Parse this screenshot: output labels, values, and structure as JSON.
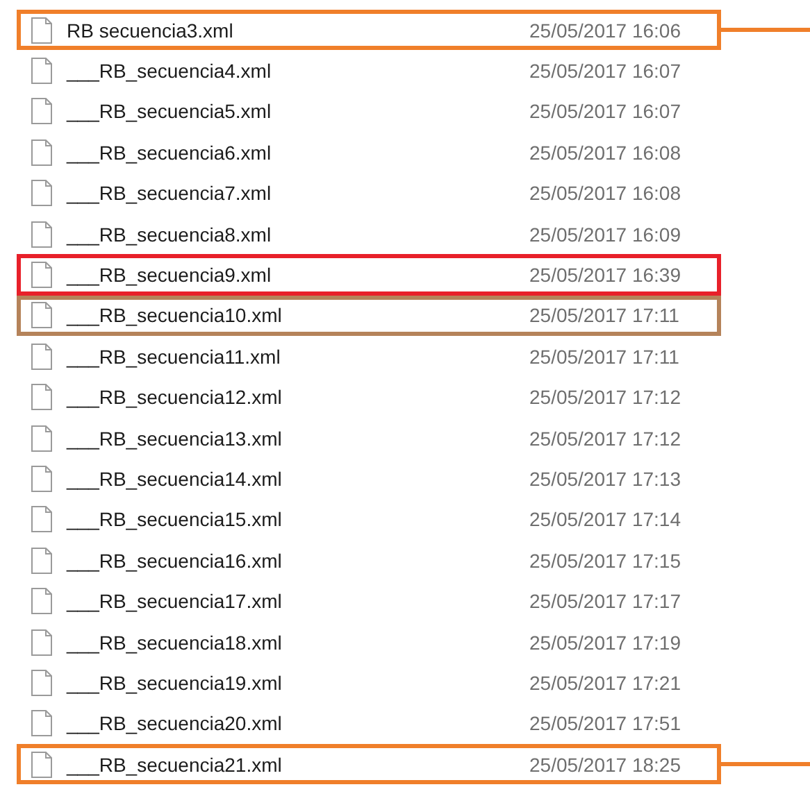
{
  "files": [
    {
      "name": "RB secuencia3.xml",
      "modified": "25/05/2017 16:06",
      "color": "#f07f2a",
      "connector": true
    },
    {
      "name": "___RB_secuencia4.xml",
      "modified": "25/05/2017 16:07"
    },
    {
      "name": "___RB_secuencia5.xml",
      "modified": "25/05/2017 16:07"
    },
    {
      "name": "___RB_secuencia6.xml",
      "modified": "25/05/2017 16:08"
    },
    {
      "name": "___RB_secuencia7.xml",
      "modified": "25/05/2017 16:08"
    },
    {
      "name": "___RB_secuencia8.xml",
      "modified": "25/05/2017 16:09"
    },
    {
      "name": "___RB_secuencia9.xml",
      "modified": "25/05/2017 16:39",
      "color": "#e8202a"
    },
    {
      "name": "___RB_secuencia10.xml",
      "modified": "25/05/2017 17:11",
      "color": "#b5835a"
    },
    {
      "name": "___RB_secuencia11.xml",
      "modified": "25/05/2017 17:11"
    },
    {
      "name": "___RB_secuencia12.xml",
      "modified": "25/05/2017 17:12"
    },
    {
      "name": "___RB_secuencia13.xml",
      "modified": "25/05/2017 17:12"
    },
    {
      "name": "___RB_secuencia14.xml",
      "modified": "25/05/2017 17:13"
    },
    {
      "name": "___RB_secuencia15.xml",
      "modified": "25/05/2017 17:14"
    },
    {
      "name": "___RB_secuencia16.xml",
      "modified": "25/05/2017 17:15"
    },
    {
      "name": "___RB_secuencia17.xml",
      "modified": "25/05/2017 17:17"
    },
    {
      "name": "___RB_secuencia18.xml",
      "modified": "25/05/2017 17:19"
    },
    {
      "name": "___RB_secuencia19.xml",
      "modified": "25/05/2017 17:21"
    },
    {
      "name": "___RB_secuencia20.xml",
      "modified": "25/05/2017 17:51"
    },
    {
      "name": "___RB_secuencia21.xml",
      "modified": "25/05/2017 18:25",
      "color": "#f07f2a",
      "connector": true
    }
  ]
}
